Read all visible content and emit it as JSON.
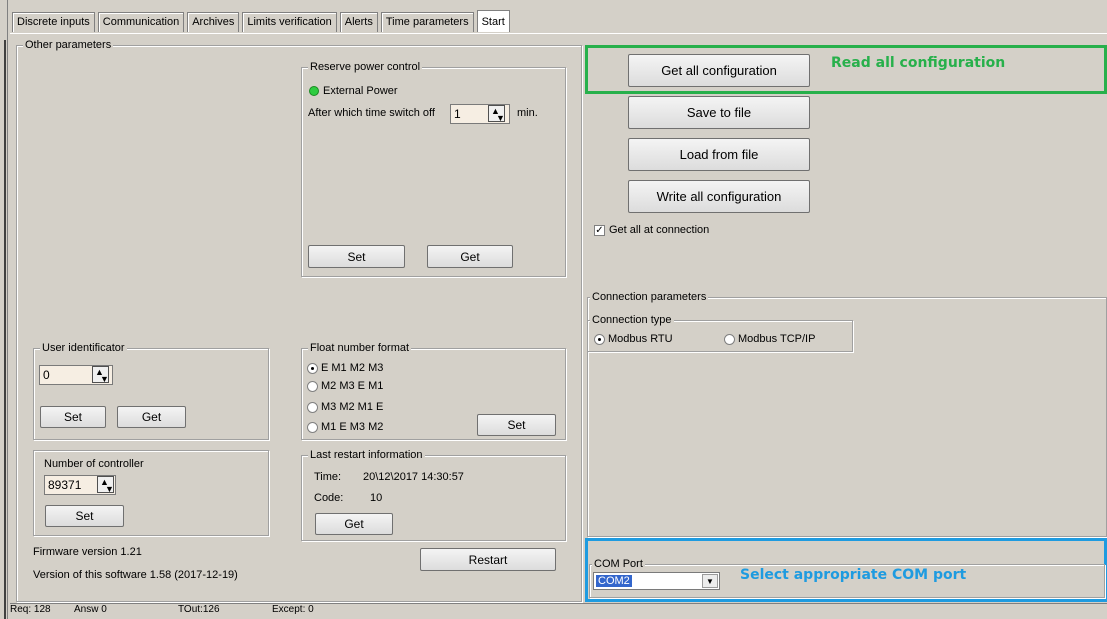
{
  "tabs": [
    "Discrete inputs",
    "Communication",
    "Archives",
    "Limits verification",
    "Alerts",
    "Time parameters",
    "Start"
  ],
  "other_params": {
    "title": "Other parameters",
    "reserve": {
      "title": "Reserve power control",
      "led_label": "External Power",
      "switch_label": "After which time switch off",
      "switch_value": "1",
      "unit": "min.",
      "set": "Set",
      "get": "Get"
    },
    "user_id": {
      "title": "User identificator",
      "value": "0",
      "set": "Set",
      "get": "Get"
    },
    "float_format": {
      "title": "Float number format",
      "options": [
        "E M1 M2 M3",
        "M2 M3 E M1",
        "M3 M2 M1 E",
        "M1 E M3 M2"
      ],
      "set": "Set"
    },
    "controller": {
      "title": "Number of controller",
      "value": "89371",
      "set": "Set"
    },
    "restart_info": {
      "title": "Last restart information",
      "time_label": "Time:",
      "time_value": "20\\12\\2017 14:30:57",
      "code_label": "Code:",
      "code_value": "10",
      "get": "Get"
    },
    "firmware": "Firmware version 1.21",
    "software": "Version of this software  1.58 (2017-12-19)",
    "restart": "Restart"
  },
  "config": {
    "get_all": "Get all configuration",
    "annot_read": "Read all configuration",
    "save": "Save to file",
    "load": "Load from file",
    "write": "Write all configuration",
    "get_at_connection": "Get all at connection"
  },
  "connection": {
    "title": "Connection parameters",
    "type_title": "Connection type",
    "rtu": "Modbus RTU",
    "tcp": "Modbus TCP/IP"
  },
  "com": {
    "title": "COM Port",
    "value": "COM2",
    "annot": "Select appropriate COM port"
  },
  "status": {
    "req": "Req: 128",
    "answ": "Answ   0",
    "tout": "TOut:126",
    "except": "Except:  0"
  },
  "colors": {
    "green_annotation": "#27b04b",
    "blue_annotation": "#1e9be0"
  }
}
